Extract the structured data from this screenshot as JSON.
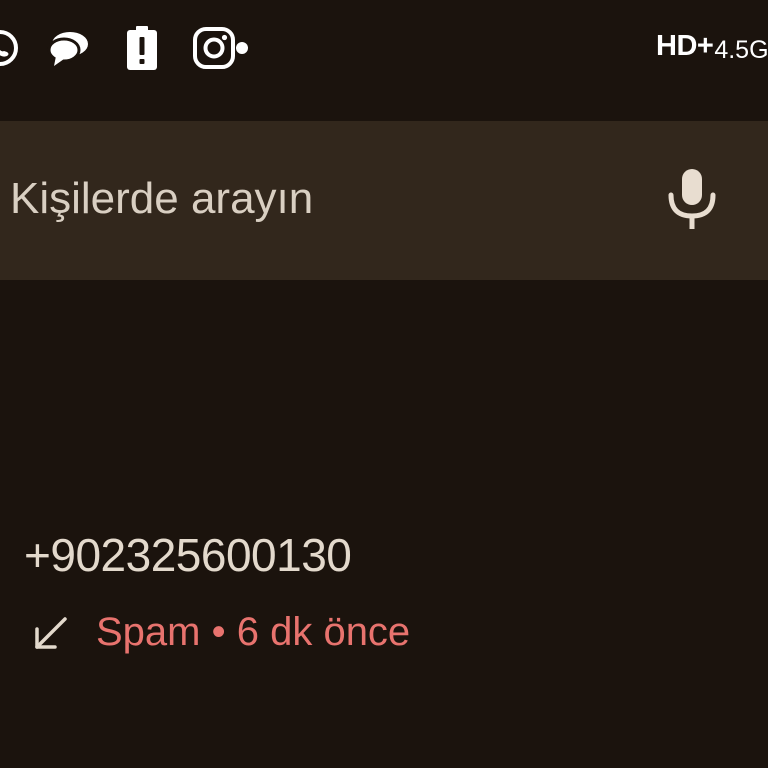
{
  "status_bar": {
    "icons": [
      "whatsapp-icon",
      "chat-bubbles-icon",
      "battery-alert-icon",
      "instagram-icon"
    ],
    "network_label": "HD+",
    "speed_label": "4.5G"
  },
  "search": {
    "placeholder": "Kişilerde arayın",
    "mic_icon": "microphone-icon"
  },
  "call_log": {
    "entries": [
      {
        "number": "+902325600130",
        "direction_icon": "incoming-call-arrow-icon",
        "status": "Spam • 6 dk önce",
        "status_color": "#e8736e"
      }
    ]
  },
  "colors": {
    "background": "#1b130d",
    "search_bar": "#32271c",
    "text": "#e6dccf",
    "spam": "#e8736e"
  }
}
